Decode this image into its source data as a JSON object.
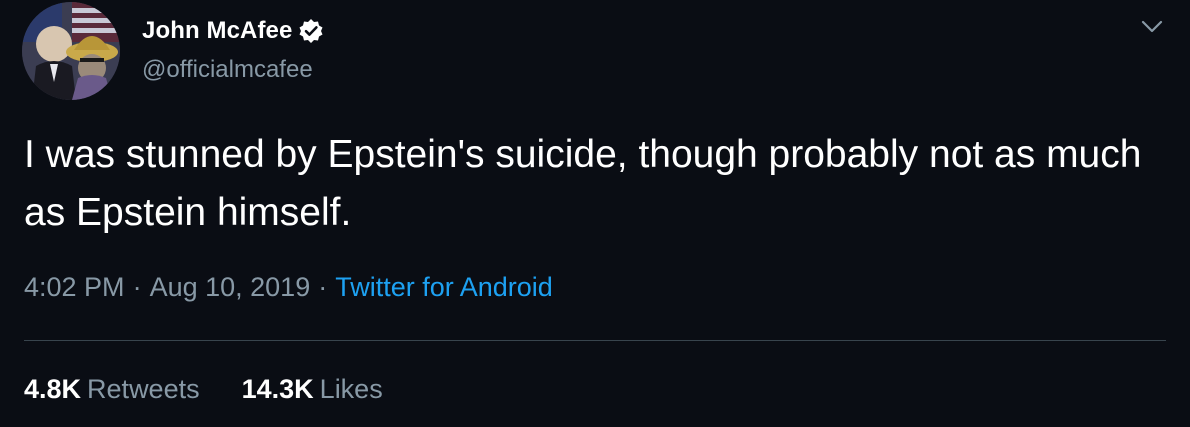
{
  "user": {
    "display_name": "John McAfee",
    "handle": "@officialmcafee",
    "verified": true
  },
  "icons": {
    "verified": "verified-badge-icon",
    "more_options": "chevron-down-icon",
    "avatar": "profile-avatar"
  },
  "tweet": {
    "text": "I was stunned by Epstein's suicide, though probably not as much as Epstein himself.",
    "time": "4:02 PM",
    "separator": "·",
    "date": "Aug 10, 2019",
    "source": "Twitter for Android"
  },
  "stats": {
    "retweets_count": "4.8K",
    "retweets_label": "Retweets",
    "likes_count": "14.3K",
    "likes_label": "Likes"
  },
  "colors": {
    "background": "#0a0d14",
    "secondary_text": "#8899a6",
    "link": "#1da1f2",
    "divider": "#38444d"
  }
}
